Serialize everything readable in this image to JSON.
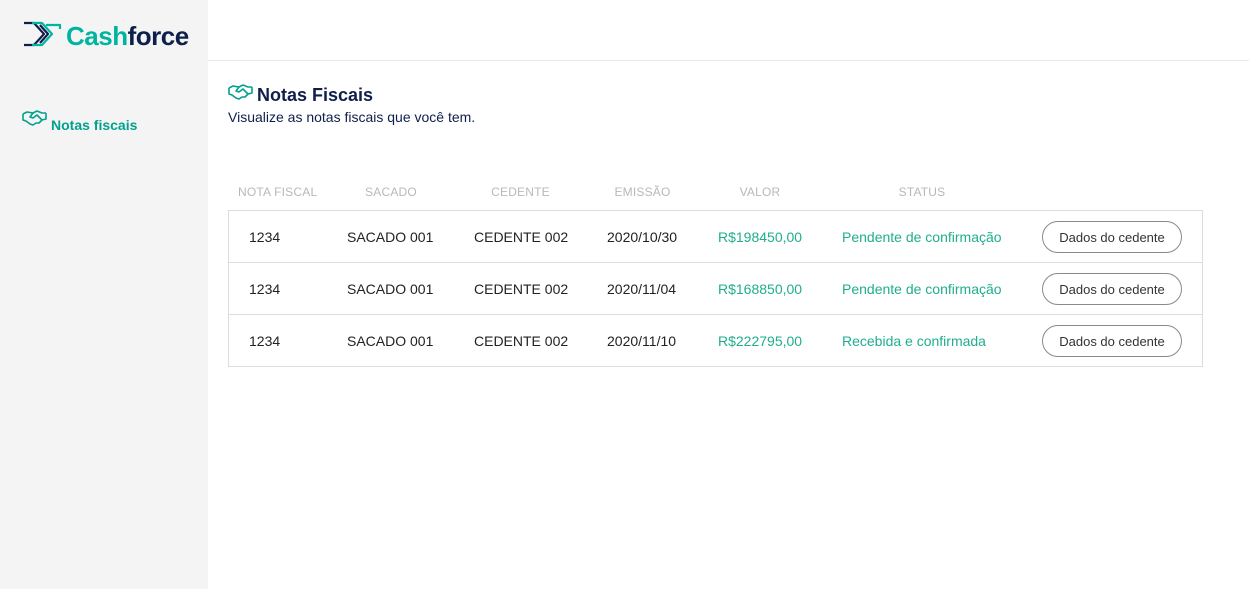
{
  "brand": {
    "name_part1": "Cash",
    "name_part2": "force",
    "primary_color": "#00b5a0",
    "dark_color": "#0f1f4b"
  },
  "sidebar": {
    "items": [
      {
        "label": "Notas fiscais",
        "icon": "handshake-icon",
        "active": true
      }
    ]
  },
  "page": {
    "title": "Notas Fiscais",
    "subtitle": "Visualize as notas fiscais que você tem.",
    "icon": "handshake-icon"
  },
  "table": {
    "columns": [
      "NOTA FISCAL",
      "SACADO",
      "CEDENTE",
      "EMISSÃO",
      "VALOR",
      "STATUS"
    ],
    "rows": [
      {
        "nota": "1234",
        "sacado": "SACADO 001",
        "cedente": "CEDENTE 002",
        "emissao": "2020/10/30",
        "valor": "R$198450,00",
        "status": "Pendente de confirmação",
        "action": "Dados do cedente"
      },
      {
        "nota": "1234",
        "sacado": "SACADO 001",
        "cedente": "CEDENTE 002",
        "emissao": "2020/11/04",
        "valor": "R$168850,00",
        "status": "Pendente de confirmação",
        "action": "Dados do cedente"
      },
      {
        "nota": "1234",
        "sacado": "SACADO 001",
        "cedente": "CEDENTE 002",
        "emissao": "2020/11/10",
        "valor": "R$222795,00",
        "status": "Recebida e confirmada",
        "action": "Dados do cedente"
      }
    ]
  }
}
